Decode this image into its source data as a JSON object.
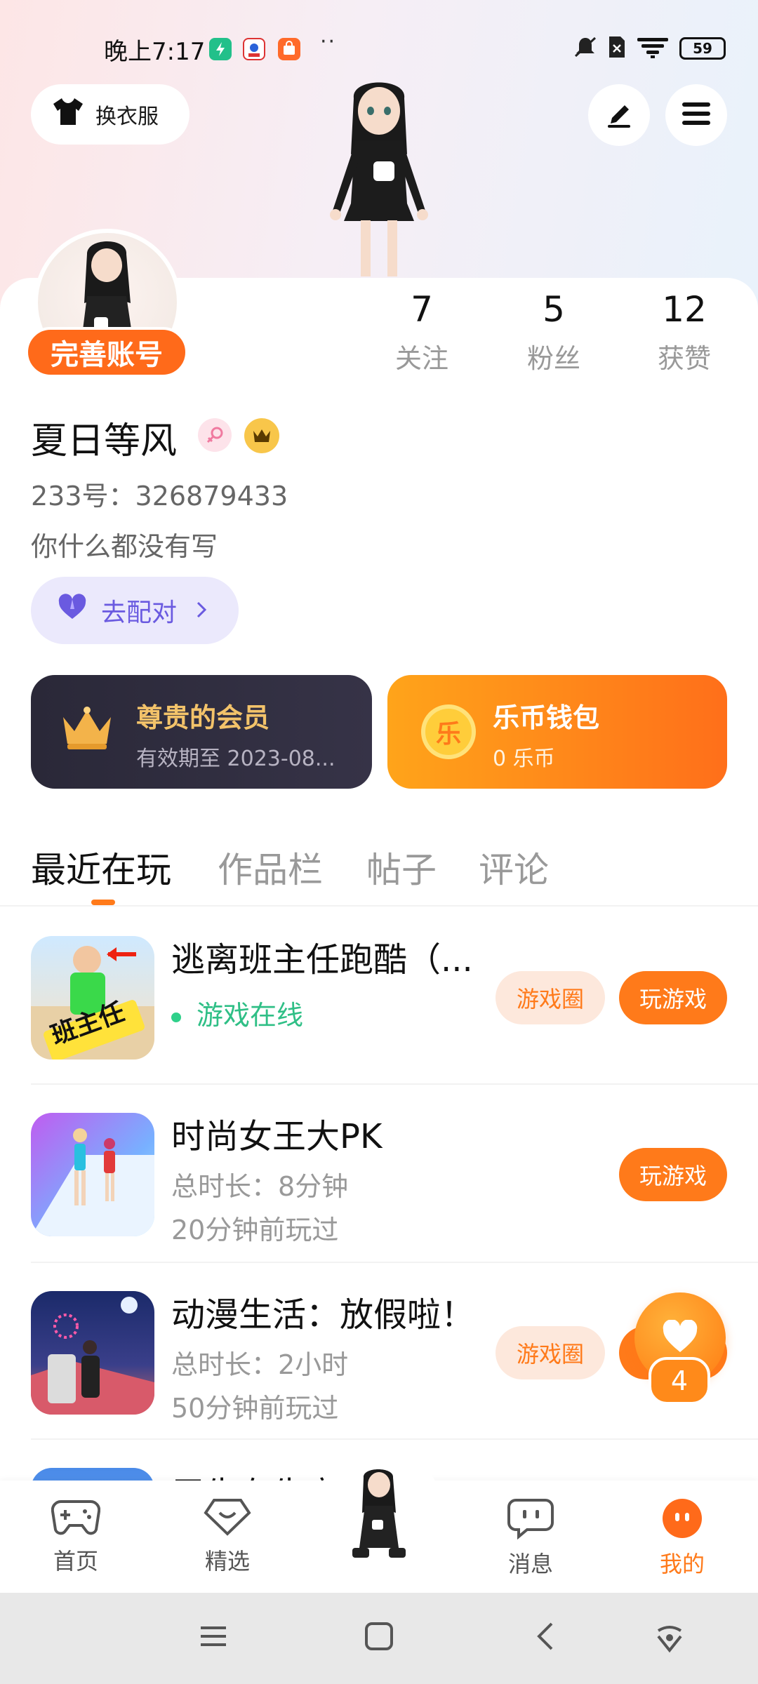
{
  "status_bar": {
    "time": "晚上7:17",
    "battery": "59"
  },
  "header": {
    "outfit_label": "换衣服"
  },
  "profile": {
    "complete_account_label": "完善账号",
    "stats": [
      {
        "value": "7",
        "label": "关注"
      },
      {
        "value": "5",
        "label": "粉丝"
      },
      {
        "value": "12",
        "label": "获赞"
      }
    ],
    "username": "夏日等风",
    "uid": "233号：326879433",
    "bio": "你什么都没有写",
    "match_label": "去配对"
  },
  "cards": {
    "vip_title": "尊贵的会员",
    "vip_subtitle": "有效期至 2023-08...",
    "wallet_title": "乐币钱包",
    "wallet_subtitle": "0 乐币",
    "wallet_coin_char": "乐"
  },
  "tabs": [
    {
      "label": "最近在玩",
      "active": true
    },
    {
      "label": "作品栏"
    },
    {
      "label": "帖子"
    },
    {
      "label": "评论"
    }
  ],
  "games": [
    {
      "title": "逃离班主任跑酷（...",
      "status": "游戏在线",
      "circle_label": "游戏圈",
      "play_label": "玩游戏",
      "thumb_text": "班主任"
    },
    {
      "title": "时尚女王大PK",
      "duration": "总时长：8分钟",
      "last_played": "20分钟前玩过",
      "play_label": "玩游戏"
    },
    {
      "title": "动漫生活：放假啦！",
      "duration": "总时长：2小时",
      "last_played": "50分钟前玩过",
      "circle_label": "游戏圈"
    },
    {
      "title": "甲生在生交"
    }
  ],
  "fab": {
    "count": "4"
  },
  "bottom_nav": [
    {
      "label": "首页"
    },
    {
      "label": "精选"
    },
    {
      "label": "消息"
    },
    {
      "label": "我的",
      "active": true
    }
  ],
  "colors": {
    "accent": "#ff7a1a",
    "online": "#2fbf86",
    "match": "#6a5ae0",
    "vip_bg": "#2a2838"
  }
}
